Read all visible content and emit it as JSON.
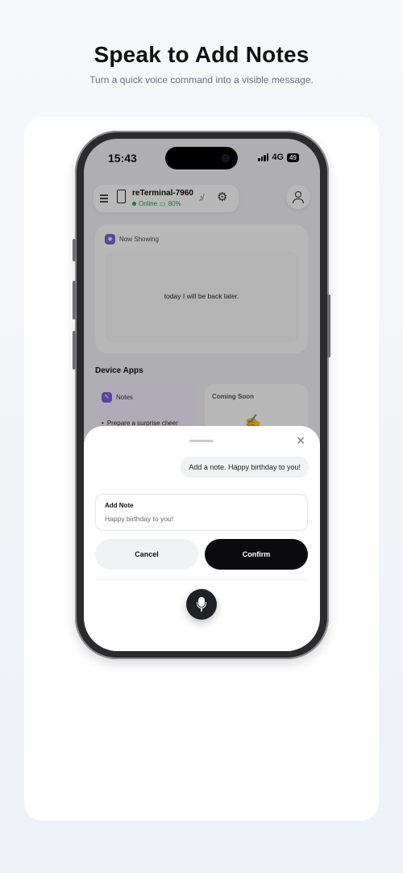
{
  "hero": {
    "title": "Speak to Add Notes",
    "subtitle": "Turn a quick voice command into a visible message."
  },
  "status_bar": {
    "time": "15:43",
    "network": "4G",
    "battery": "49"
  },
  "device": {
    "name": "reTerminal-7960",
    "status": "Online",
    "battery": "80%"
  },
  "now_showing": {
    "label": "Now Showing",
    "text": "today I will be back later."
  },
  "apps": {
    "title": "Device Apps",
    "notes_label": "Notes",
    "notes_item": "Prepare a surprise cheer",
    "coming_soon_label": "Coming Soon"
  },
  "sheet": {
    "chat_bubble": "Add a note. Happy birthday to you!",
    "note_label": "Add Note",
    "note_value": "Happy birthday to you!",
    "cancel_label": "Cancel",
    "confirm_label": "Confirm"
  },
  "icons": {
    "menu": "menu-icon",
    "device": "device-icon",
    "mute": "mute-icon",
    "settings": "gear-icon",
    "profile": "user-icon",
    "close": "close-icon",
    "mic": "mic-icon"
  },
  "colors": {
    "accent_purple": "#7d5fd3",
    "online_green": "#22a35a",
    "confirm_black": "#0b0b0d"
  }
}
